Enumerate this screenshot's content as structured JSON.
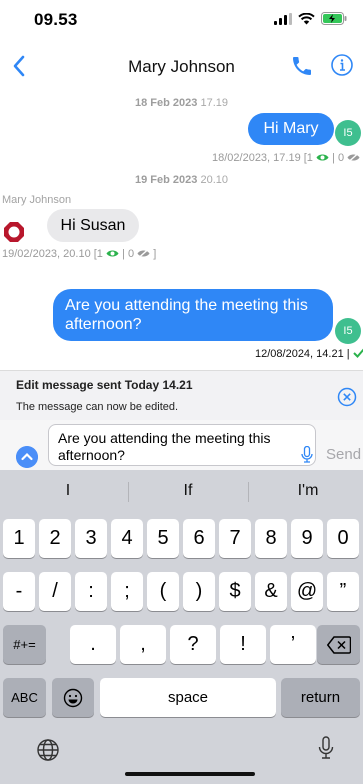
{
  "status_bar": {
    "time": "09.53"
  },
  "nav": {
    "title": "Mary Johnson"
  },
  "messages": {
    "date1": {
      "day": "18 Feb 2023",
      "time": "17.19"
    },
    "msg1": {
      "text": "Hi Mary",
      "avatar": "I5",
      "meta": "18/02/2023, 17.19  [1",
      "meta_tail": "| 0"
    },
    "date2": {
      "day": "19 Feb 2023",
      "time": "20.10"
    },
    "msg2": {
      "sender": "Mary Johnson",
      "text": "Hi Susan",
      "meta": "19/02/2023, 20.10  [1",
      "meta_tail": "| 0",
      "meta_end": "]"
    },
    "msg3": {
      "text": "Are you attending the meeting this afternoon?",
      "avatar": "I5",
      "meta": "12/08/2024, 14.21  |"
    }
  },
  "edit_bar": {
    "title": "Edit message sent Today 14.21",
    "subtitle": "The message can now be edited."
  },
  "composer": {
    "value": "Are you attending the meeting this afternoon?",
    "send_label": "Send"
  },
  "keyboard": {
    "suggestions": [
      "I",
      "If",
      "I'm"
    ],
    "row1": [
      "1",
      "2",
      "3",
      "4",
      "5",
      "6",
      "7",
      "8",
      "9",
      "0"
    ],
    "row2": [
      "-",
      "/",
      ":",
      ";",
      "(",
      ")",
      "$",
      "&",
      "@",
      "”"
    ],
    "row3": [
      ".",
      ",",
      "?",
      "!",
      "’"
    ],
    "shift_label": "#+=",
    "abc_label": "ABC",
    "space_label": "space",
    "return_label": "return"
  },
  "colors": {
    "accent": "#2f87f6",
    "avatar": "#3fbf8f",
    "read_green": "#2bb24c"
  }
}
